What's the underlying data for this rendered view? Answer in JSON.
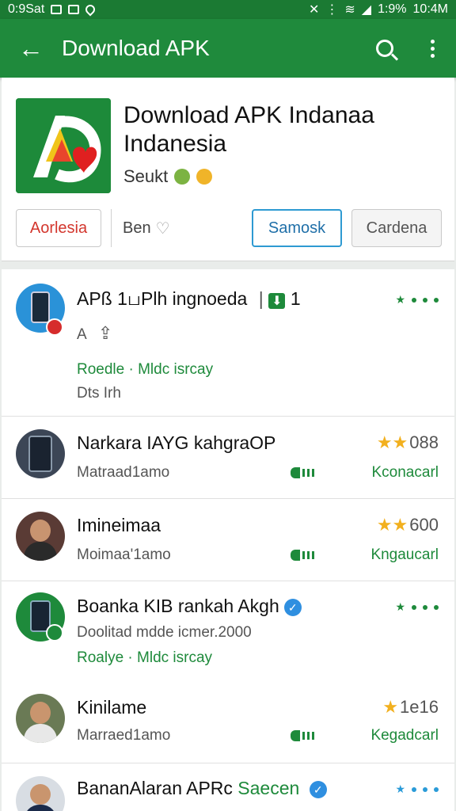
{
  "status_bar": {
    "left_text": "0:9Sat",
    "battery": "1:9%",
    "time": "10:4M"
  },
  "app_bar": {
    "title": "Download APK",
    "back_icon": "arrow-left-icon",
    "search_icon": "search-icon",
    "menu_icon": "more-vert-icon"
  },
  "header": {
    "title": "Download APK Indanaa Indanesia",
    "subtitle": "Seukt",
    "buttons": [
      "Aorlesia",
      "Ben",
      "Samosk",
      "Cardena"
    ]
  },
  "list": [
    {
      "title": "APß 1பPlh ingnoeda",
      "badge": "1",
      "line1": "A",
      "green": "Roedle · Mldc isrcay",
      "line2": "Dts Irh"
    },
    {
      "title": "Narkara IAYG kahgraOP",
      "line1": "Matraad1amo",
      "rating": "088",
      "install": "Kconacarl"
    },
    {
      "title": "Imineimaa",
      "line1": "Moimaa'1amo",
      "rating": "600",
      "install": "Kngaucarl"
    },
    {
      "title": "Boanka KIB rankah Akgh",
      "line1": "Doolitad mdde icmer.2000",
      "green": "Roalye · Mldc isrcay"
    },
    {
      "title": "Kinilame",
      "line1": "Marraed1amo",
      "rating": "1e16",
      "install": "Kegadcarl"
    },
    {
      "title": "BananAlaran APRc",
      "title_green": "Saecen"
    }
  ],
  "colors": {
    "primary": "#1f8a3c",
    "status": "#1b7a33",
    "accent_blue": "#2e9ad2",
    "accent_red": "#d3362d",
    "star": "#f2b01e"
  }
}
